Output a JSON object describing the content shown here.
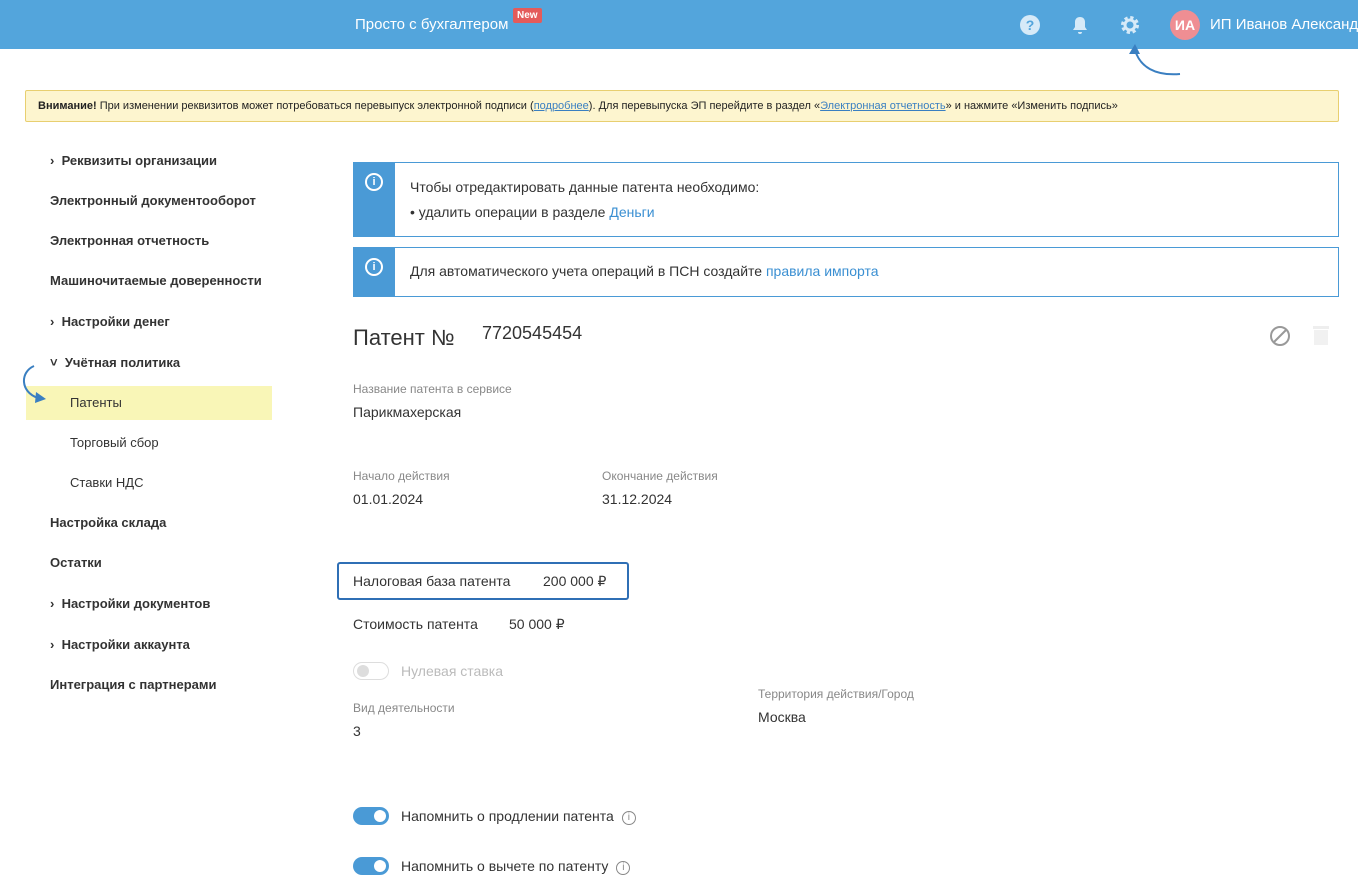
{
  "header": {
    "brand": "Просто с бухгалтером",
    "new_badge": "New",
    "avatar_initials": "ИА",
    "user_name": "ИП Иванов Александ"
  },
  "warning": {
    "bold": "Внимание!",
    "text1": " При изменении реквизитов может потребоваться перевыпуск электронной подписи (",
    "link1": "подробнее",
    "text2": "). Для перевыпуска ЭП перейдите в раздел «",
    "link2": "Электронная отчетность",
    "text3": "» и нажмите «Изменить подпись»"
  },
  "sidebar": {
    "items": [
      "Реквизиты организации",
      "Электронный документооборот",
      "Электронная отчетность",
      "Машиночитаемые доверенности",
      "Настройки денег",
      "Учётная политика",
      "Патенты",
      "Торговый сбор",
      "Ставки НДС",
      "Настройка склада",
      "Остатки",
      "Настройки документов",
      "Настройки аккаунта",
      "Интеграция с партнерами"
    ]
  },
  "info1": {
    "line1": "Чтобы отредактировать данные патента необходимо:",
    "line2": "• удалить операции в разделе ",
    "link": "Деньги"
  },
  "info2": {
    "text": "Для автоматического учета операций в ПСН создайте ",
    "link": "правила импорта"
  },
  "patent": {
    "title": "Патент №",
    "number": "7720545454",
    "name_label": "Название патента в сервисе",
    "name": "Парикмахерская",
    "start_label": "Начало действия",
    "start": "01.01.2024",
    "end_label": "Окончание действия",
    "end": "31.12.2024",
    "tax_base_label": "Налоговая база патента",
    "tax_base": "200 000 ₽",
    "cost_label": "Стоимость патента",
    "cost": "50 000 ₽",
    "zero_rate": "Нулевая ставка",
    "activity_label": "Вид деятельности",
    "activity": "3",
    "territory_label": "Территория действия/Город",
    "territory": "Москва",
    "remind_renew": "Напомнить о продлении патента",
    "remind_deduct": "Напомнить о вычете по патенту"
  }
}
